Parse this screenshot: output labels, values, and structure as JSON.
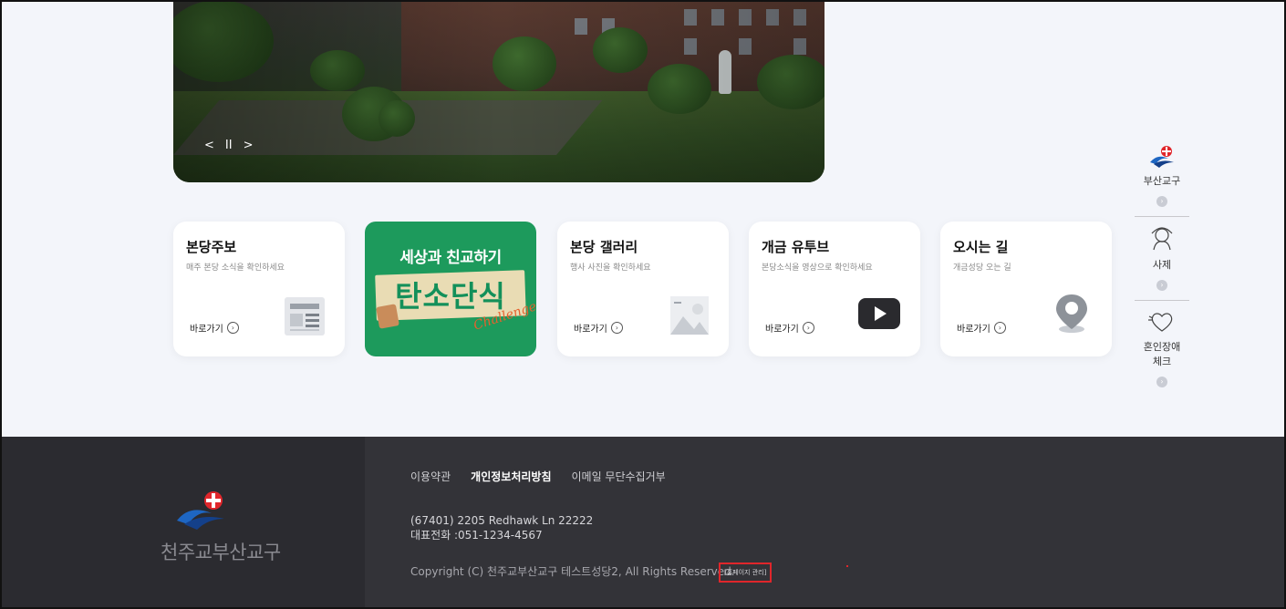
{
  "hero": {
    "prev": "<",
    "pause": "II",
    "next": ">"
  },
  "cards": [
    {
      "title": "본당주보",
      "desc": "매주 본당 소식을 확인하세요",
      "link": "바로가기",
      "icon": "newspaper-icon"
    },
    {
      "title": "본당 갤러리",
      "desc": "행사 사진을 확인하세요",
      "link": "바로가기",
      "icon": "image-icon"
    },
    {
      "title": "개금 유투브",
      "desc": "본당소식을 영상으로 확인하세요",
      "link": "바로가기",
      "icon": "play-icon"
    },
    {
      "title": "오시는 길",
      "desc": "개금성당 오는 길",
      "link": "바로가기",
      "icon": "map-pin-icon"
    }
  ],
  "promo": {
    "line1": "세상과 친교하기",
    "line2": "탄소단식",
    "line3": "Challenge"
  },
  "side_menu": [
    {
      "label": "부산교구",
      "icon": "diocese-logo-icon"
    },
    {
      "label": "사제",
      "icon": "priest-icon"
    },
    {
      "label": "혼인장애 체크",
      "icon": "heart-icon"
    }
  ],
  "footer": {
    "brand": "천주교부산교구",
    "links": [
      "이용약관",
      "개인정보처리방침",
      "이메일 무단수집거부"
    ],
    "address": "(67401) 2205 Redhawk Ln 22222",
    "phone": "대표전화 :051-1234-4567",
    "copyright": "Copyright (C) 천주교부산교구 테스트성당2, All Rights Reserved.",
    "admin_label": "[홈페이지 관리]"
  },
  "colors": {
    "promo_green": "#1d9a5c",
    "footer_dark": "#2b2b30",
    "admin_border": "#e0262b"
  }
}
